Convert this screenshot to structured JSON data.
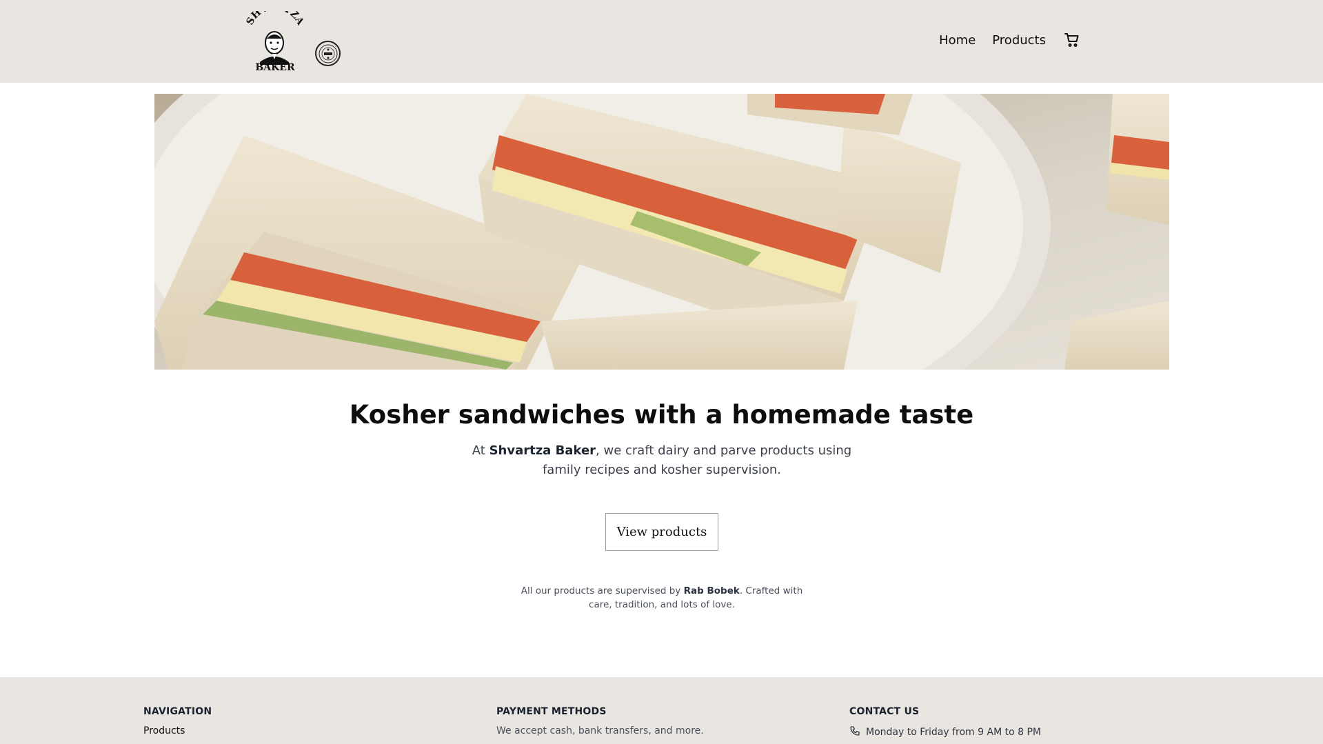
{
  "header": {
    "nav": {
      "home": "Home",
      "products": "Products"
    }
  },
  "hero": {
    "image_alt": "Sandwiches on a plate"
  },
  "main": {
    "title": "Kosher sandwiches with a homemade taste",
    "lead_prefix": "At ",
    "lead_brand": "Shvartza Baker",
    "lead_suffix": ", we craft dairy and parve products using family recipes and kosher supervision.",
    "cta_label": "View products",
    "note_prefix": "All our products are supervised by ",
    "note_name": "Rab Bobek",
    "note_suffix": ". Crafted with care, tradition, and lots of love."
  },
  "footer": {
    "navigation": {
      "heading": "NAVIGATION",
      "items": [
        "Products"
      ]
    },
    "payment": {
      "heading": "PAYMENT METHODS",
      "text": "We accept cash, bank transfers, and more."
    },
    "contact": {
      "heading": "CONTACT US",
      "hours": "Monday to Friday from 9 AM to 8 PM"
    }
  },
  "logo": {
    "lettering_top": "SHVARTZA",
    "lettering_bottom": "BAKER"
  },
  "colors": {
    "header_bg": "#e9e5e0",
    "footer_bg": "#e9e5e0",
    "text": "#111111"
  }
}
